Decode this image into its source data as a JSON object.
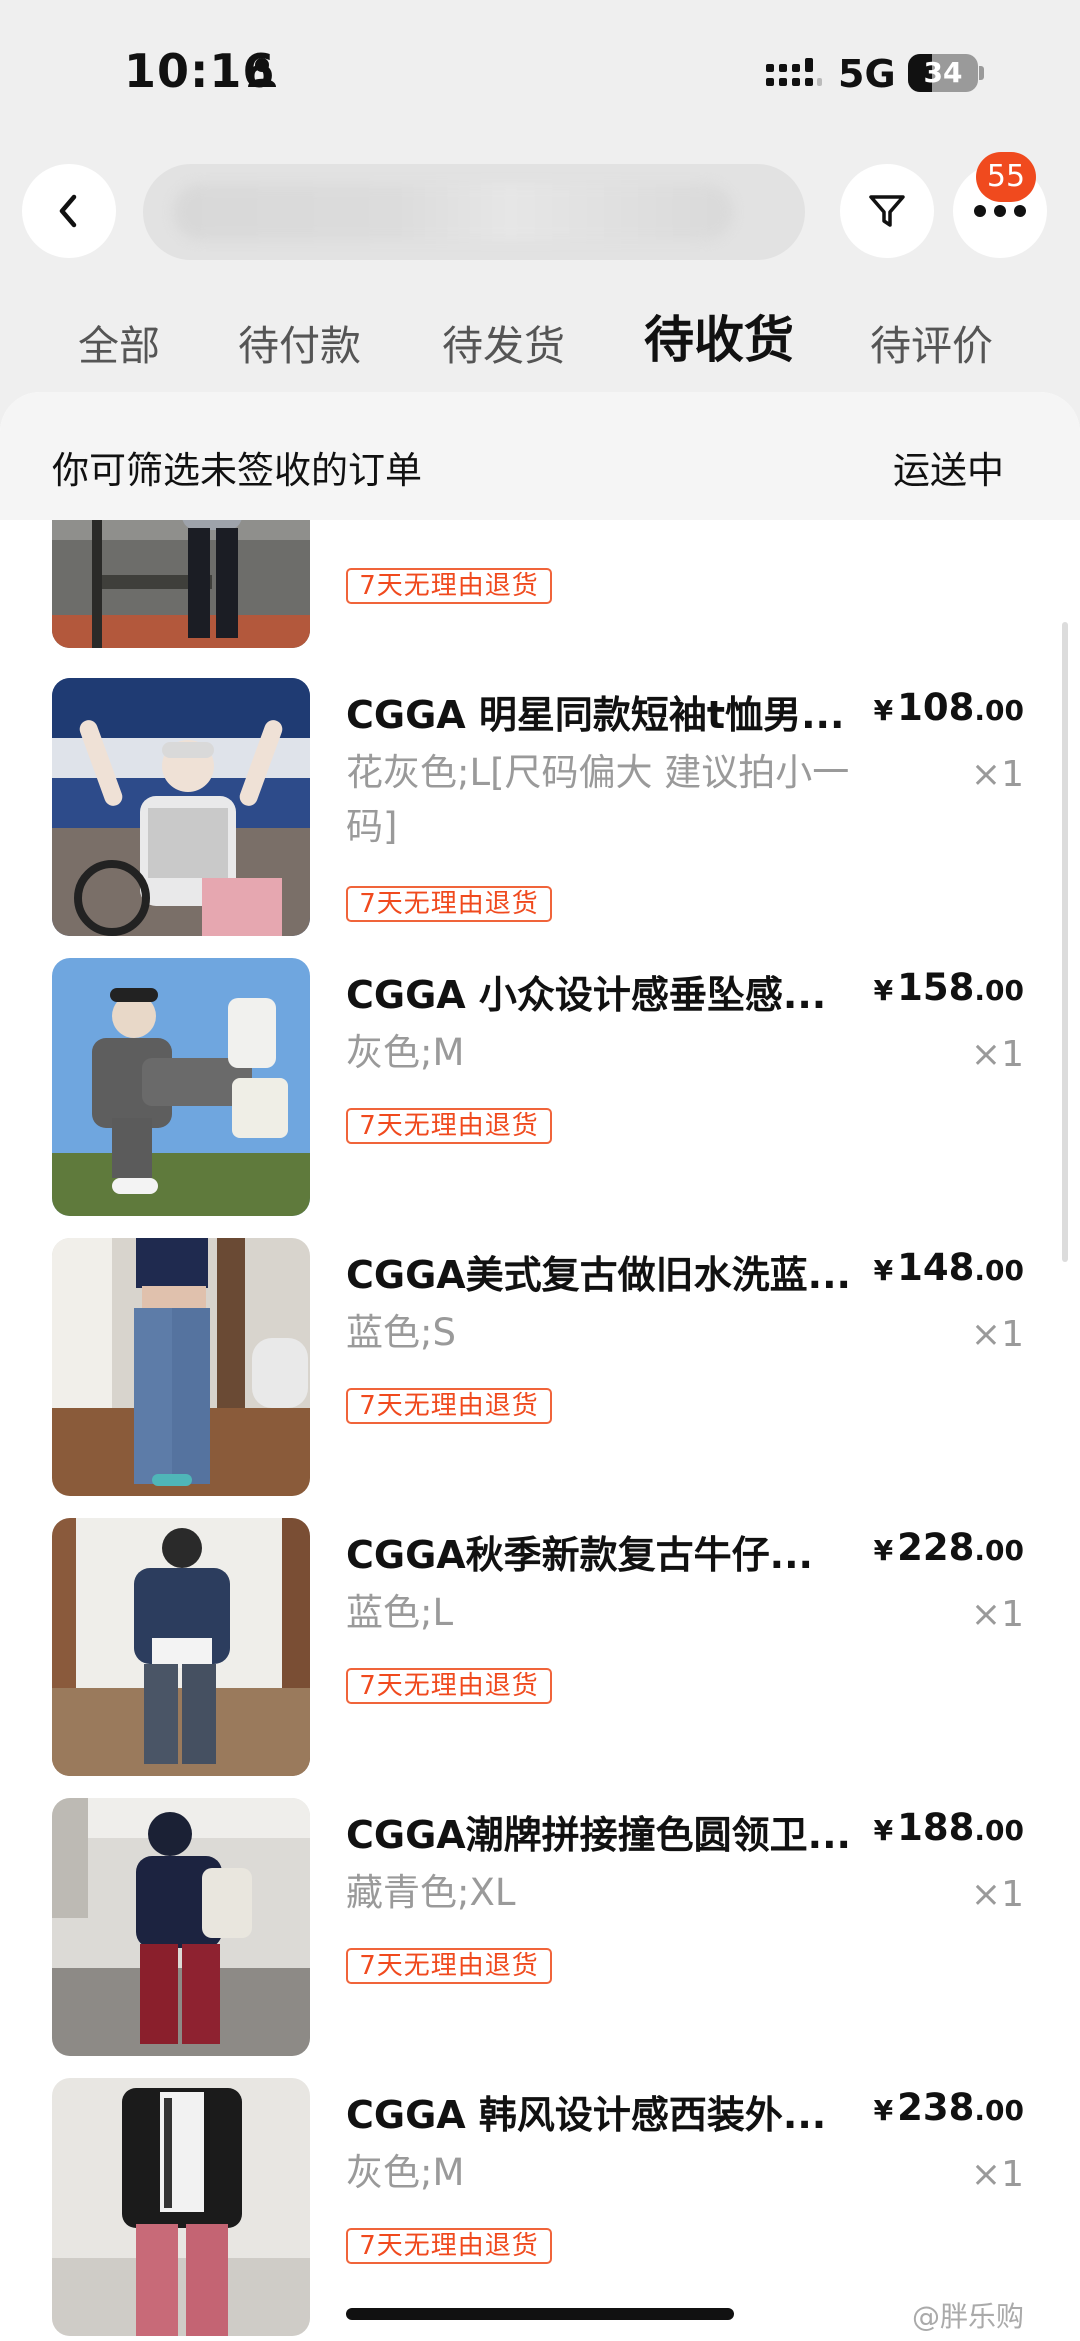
{
  "status_bar": {
    "time": "10:16",
    "network": "5G",
    "battery": "34",
    "battery_level": 0.34
  },
  "header": {
    "back_icon": "chevron-left-icon",
    "filter_icon": "filter-icon",
    "more_icon": "more-dots-icon",
    "more_badge": "55"
  },
  "tabs": [
    {
      "label": "全部",
      "active": false
    },
    {
      "label": "待付款",
      "active": false
    },
    {
      "label": "待发货",
      "active": false
    },
    {
      "label": "待收货",
      "active": true
    },
    {
      "label": "待评价",
      "active": false
    }
  ],
  "filter_bar": {
    "hint": "你可筛选未签收的订单",
    "status": "运送中"
  },
  "return_policy_label": "7天无理由退货",
  "items": [
    {
      "title": "CGGA 明星同款短袖t恤男...",
      "price_currency": "¥",
      "price_int": "108",
      "price_dec": ".00",
      "spec": "花灰色;L[尺码偏大 建议拍小一码]",
      "qty": "×1"
    },
    {
      "title": "CGGA 小众设计感垂坠感...",
      "price_currency": "¥",
      "price_int": "158",
      "price_dec": ".00",
      "spec": "灰色;M",
      "qty": "×1"
    },
    {
      "title": "CGGA美式复古做旧水洗蓝...",
      "price_currency": "¥",
      "price_int": "148",
      "price_dec": ".00",
      "spec": "蓝色;S",
      "qty": "×1"
    },
    {
      "title": "CGGA秋季新款复古牛仔...",
      "price_currency": "¥",
      "price_int": "228",
      "price_dec": ".00",
      "spec": "蓝色;L",
      "qty": "×1"
    },
    {
      "title": "CGGA潮牌拼接撞色圆领卫...",
      "price_currency": "¥",
      "price_int": "188",
      "price_dec": ".00",
      "spec": "藏青色;XL",
      "qty": "×1"
    },
    {
      "title": "CGGA 韩风设计感西装外...",
      "price_currency": "¥",
      "price_int": "238",
      "price_dec": ".00",
      "spec": "灰色;M",
      "qty": "×1"
    }
  ],
  "watermark": "@胖乐购"
}
